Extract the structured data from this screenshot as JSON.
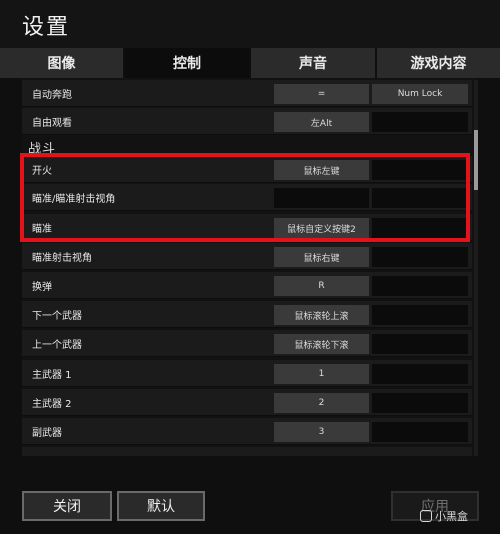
{
  "window": {
    "title": "设置"
  },
  "tabs": [
    {
      "label": "图像",
      "active": false
    },
    {
      "label": "控制",
      "active": true
    },
    {
      "label": "声音",
      "active": false
    },
    {
      "label": "游戏内容",
      "active": false
    }
  ],
  "bindings": {
    "row_auto_run": {
      "label": "自动奔跑",
      "primary": "=",
      "secondary": "Num Lock"
    },
    "row_free_look": {
      "label": "自由观看",
      "primary": "左Alt",
      "secondary": ""
    },
    "section_combat": "战斗",
    "row_fire": {
      "label": "开火",
      "primary": "鼠标左键",
      "secondary": ""
    },
    "row_aim_view": {
      "label": "瞄准/瞄准射击视角",
      "primary": "",
      "secondary": ""
    },
    "row_aim": {
      "label": "瞄准",
      "primary": "鼠标自定义按键2",
      "secondary": ""
    },
    "row_aim_shoot_view": {
      "label": "瞄准射击视角",
      "primary": "鼠标右键",
      "secondary": ""
    },
    "row_reload": {
      "label": "换弹",
      "primary": "R",
      "secondary": ""
    },
    "row_next_weapon": {
      "label": "下一个武器",
      "primary": "鼠标滚轮上滚",
      "secondary": ""
    },
    "row_prev_weapon": {
      "label": "上一个武器",
      "primary": "鼠标滚轮下滚",
      "secondary": ""
    },
    "row_primary1": {
      "label": "主武器 1",
      "primary": "1",
      "secondary": ""
    },
    "row_primary2": {
      "label": "主武器 2",
      "primary": "2",
      "secondary": ""
    },
    "row_secondary": {
      "label": "副武器",
      "primary": "3",
      "secondary": ""
    }
  },
  "footer": {
    "close_label": "关闭",
    "default_label": "默认",
    "apply_label": "应用"
  },
  "watermark": {
    "text": "小黑盒"
  },
  "colors": {
    "highlight": "#e3121b",
    "active_tab": "#0c0c0c"
  }
}
